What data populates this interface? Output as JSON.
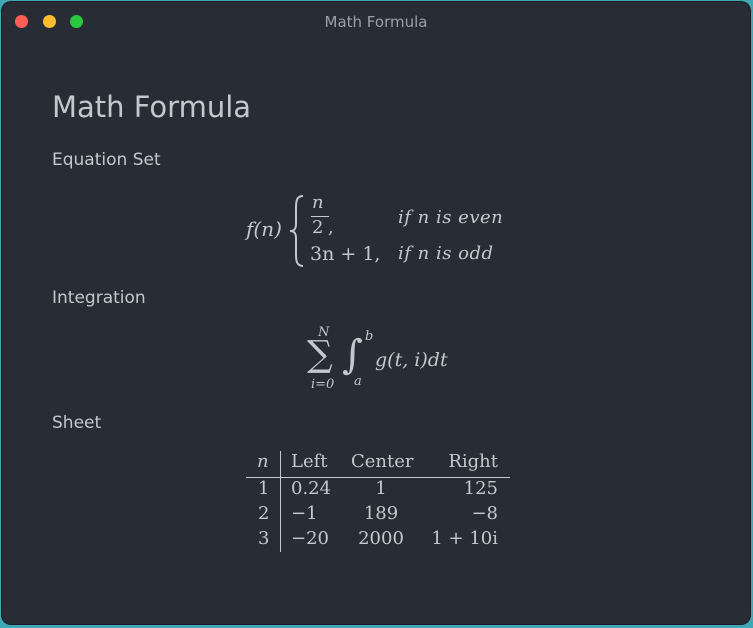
{
  "window": {
    "title": "Math Formula"
  },
  "page": {
    "title": "Math Formula",
    "sections": {
      "equation": "Equation Set",
      "integration": "Integration",
      "sheet": "Sheet"
    }
  },
  "equation_set": {
    "lhs": "f(n)",
    "case1_num": "n",
    "case1_den": "2",
    "case1_comma": ",",
    "case1_cond": "if n is even",
    "case2_expr": "3n + 1,",
    "case2_cond": "if n is odd"
  },
  "integration": {
    "sum_upper": "N",
    "sum_lower": "i=0",
    "int_upper": "b",
    "int_lower": "a",
    "integrand": "g(t, i)dt"
  },
  "sheet": {
    "headers": [
      "n",
      "Left",
      "Center",
      "Right"
    ],
    "rows": [
      [
        "1",
        "0.24",
        "1",
        "125"
      ],
      [
        "2",
        "−1",
        "189",
        "−8"
      ],
      [
        "3",
        "−20",
        "2000",
        "1 + 10i"
      ]
    ]
  },
  "icons": {
    "close": "close-dot-icon",
    "minimize": "minimize-dot-icon",
    "zoom": "zoom-dot-icon"
  }
}
